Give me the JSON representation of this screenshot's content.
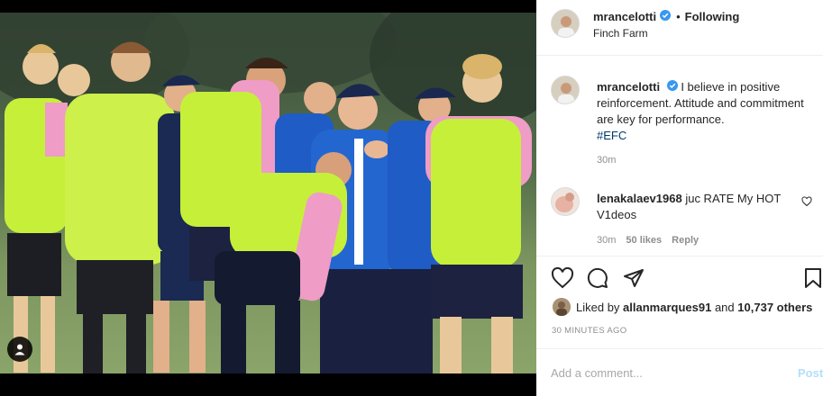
{
  "post": {
    "username": "mrancelotti",
    "follow_status": "Following",
    "separator": "•",
    "location": "Finch Farm",
    "verified_color": "#3897f0"
  },
  "caption": {
    "username": "mrancelotti",
    "text": "I believe in positive reinforcement. Attitude and commitment are key for performance.",
    "hashtag": "#EFC",
    "time": "30m"
  },
  "comment": {
    "username": "lenakalaev1968",
    "text": "juc RATE My HOT V1deos",
    "time": "30m",
    "likes": "50 likes",
    "reply": "Reply"
  },
  "likes": {
    "prefix": "Liked by",
    "user": "allanmarques91",
    "and": "and",
    "count": "10,737 others"
  },
  "timestamp": "30 MINUTES AGO",
  "comment_box": {
    "placeholder": "Add a comment...",
    "post_label": "Post"
  },
  "photo": {
    "description_icon": "user-tag-icon"
  },
  "colors": {
    "bib_yellow": "#c6ef3a",
    "shirt_pink": "#ef9cc6",
    "kit_blue": "#1f5cc6",
    "grass": "#7f9a5c",
    "link": "#00376b",
    "secondary_text": "#8e8e8e"
  }
}
